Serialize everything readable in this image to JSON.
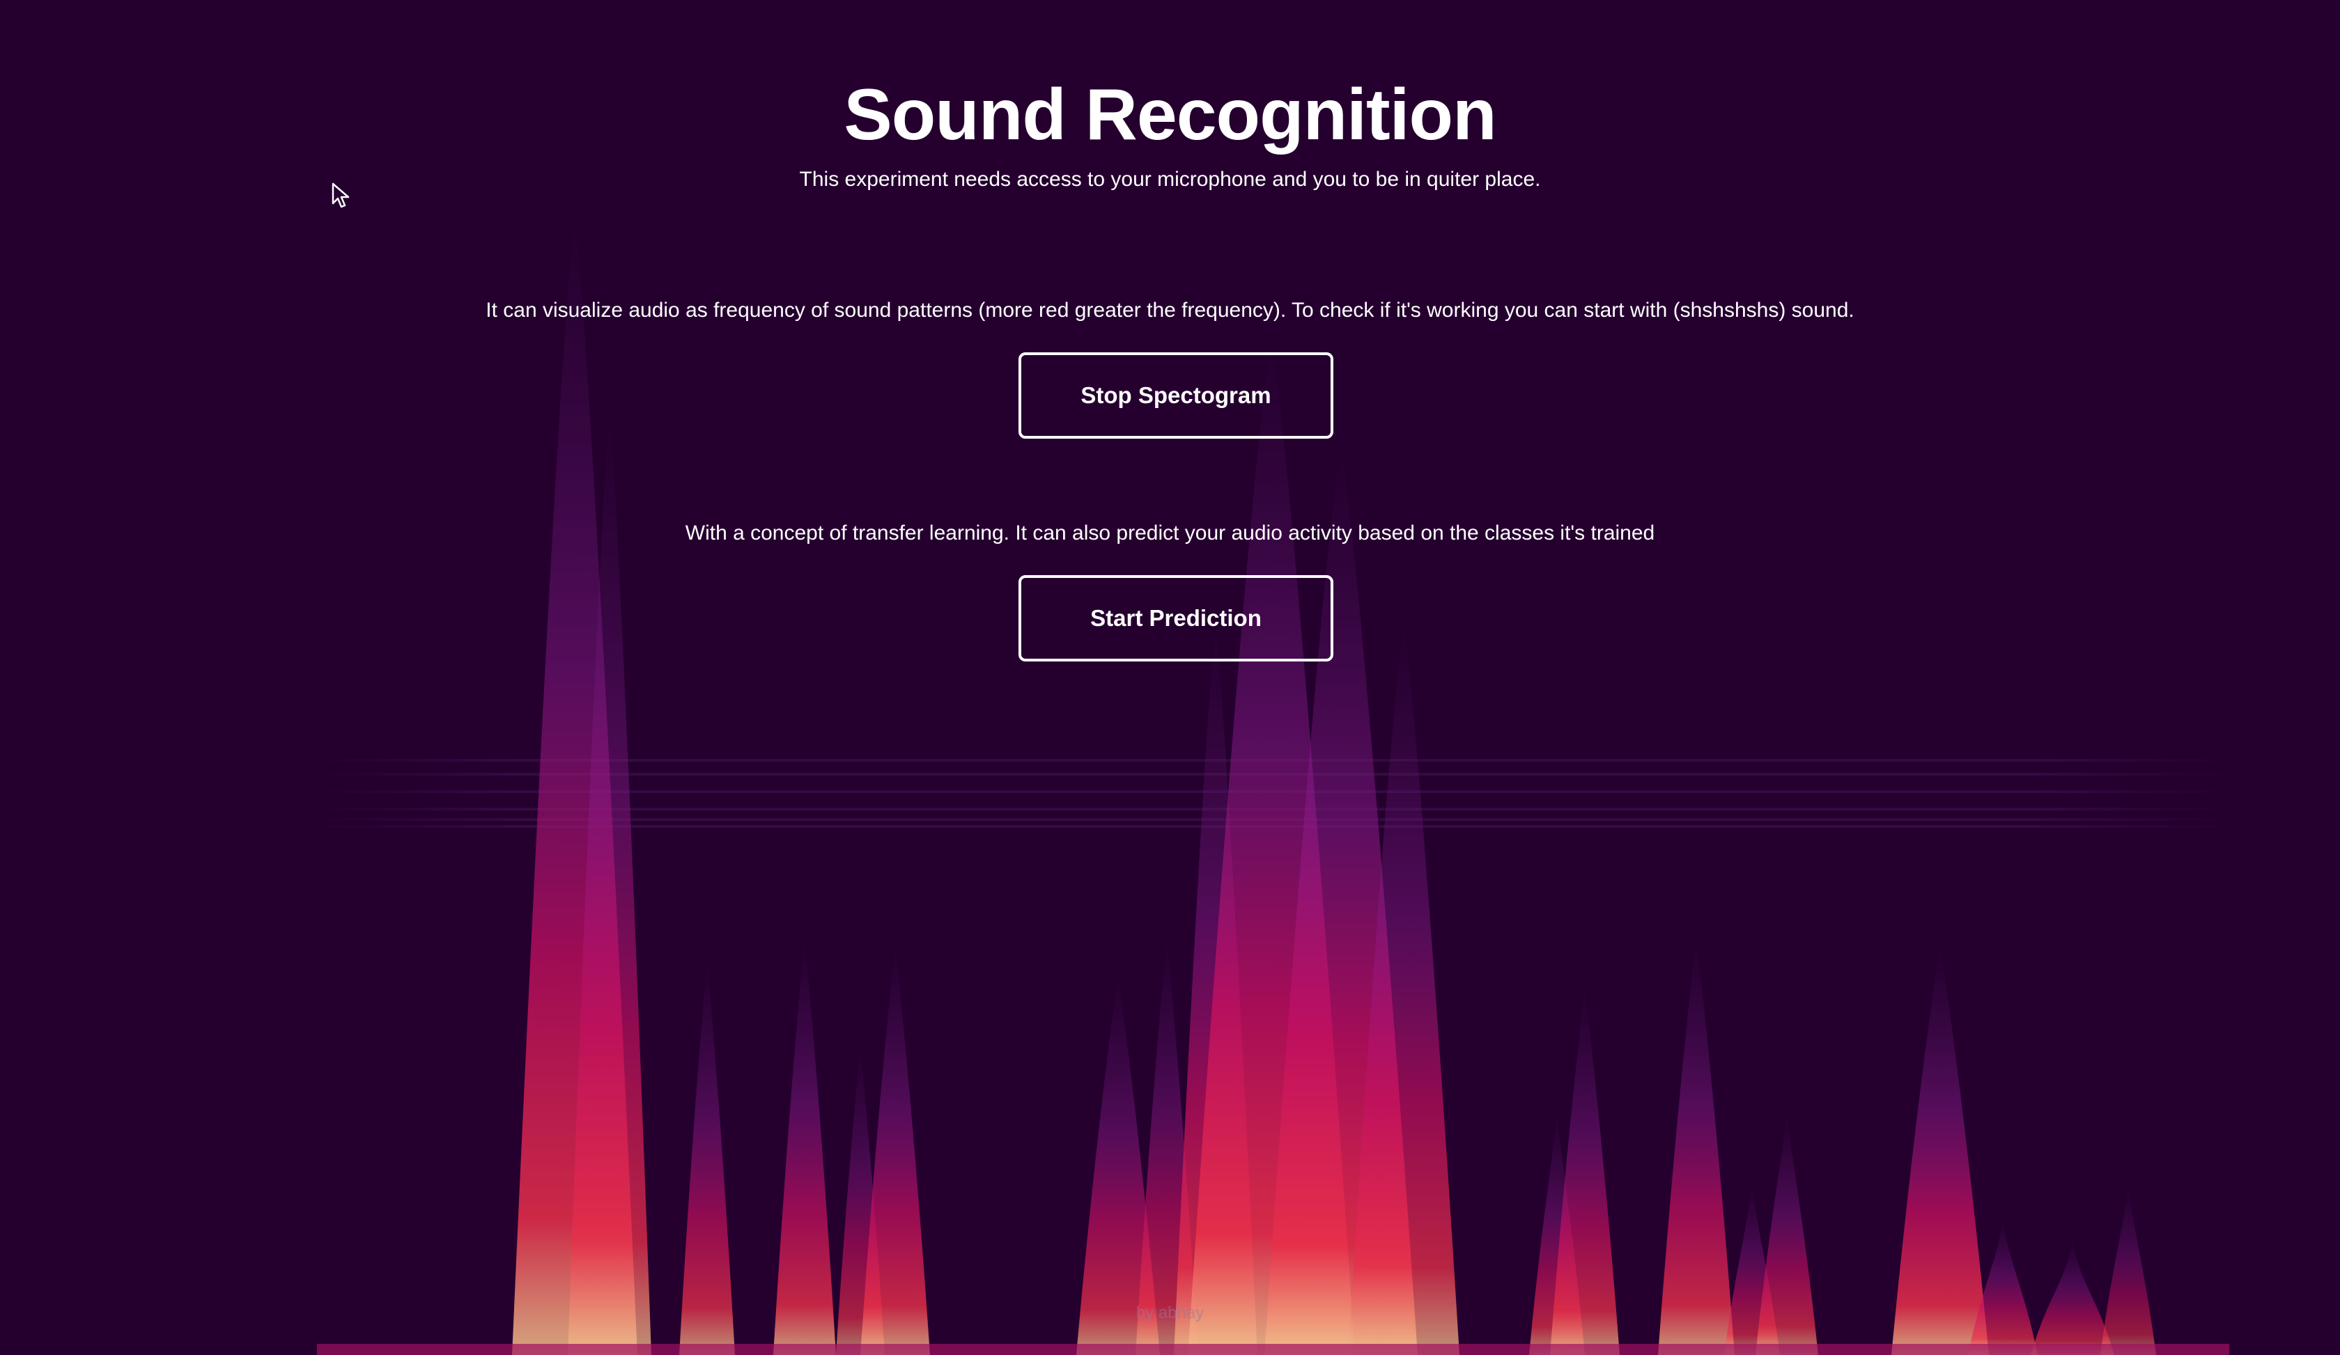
{
  "header": {
    "title": "Sound Recognition",
    "subtitle": "This experiment needs access to your microphone and you to be in quiter place."
  },
  "spectrogram_section": {
    "description": "It can visualize audio as frequency of sound patterns (more red greater the frequency). To check if it's working you can start with (shshshshs) sound.",
    "button_label": "Stop Spectogram"
  },
  "prediction_section": {
    "description": "With a concept of transfer learning. It can also predict your audio activity based on the classes it's trained",
    "button_label": "Start Prediction"
  },
  "footer": {
    "text": "by abhay"
  },
  "colors": {
    "background": "#25002f",
    "spectrogram_low": "#3a0050",
    "spectrogram_mid": "#b0106a",
    "spectrogram_high": "#e0203a",
    "spectrogram_peak": "#f0c090"
  }
}
